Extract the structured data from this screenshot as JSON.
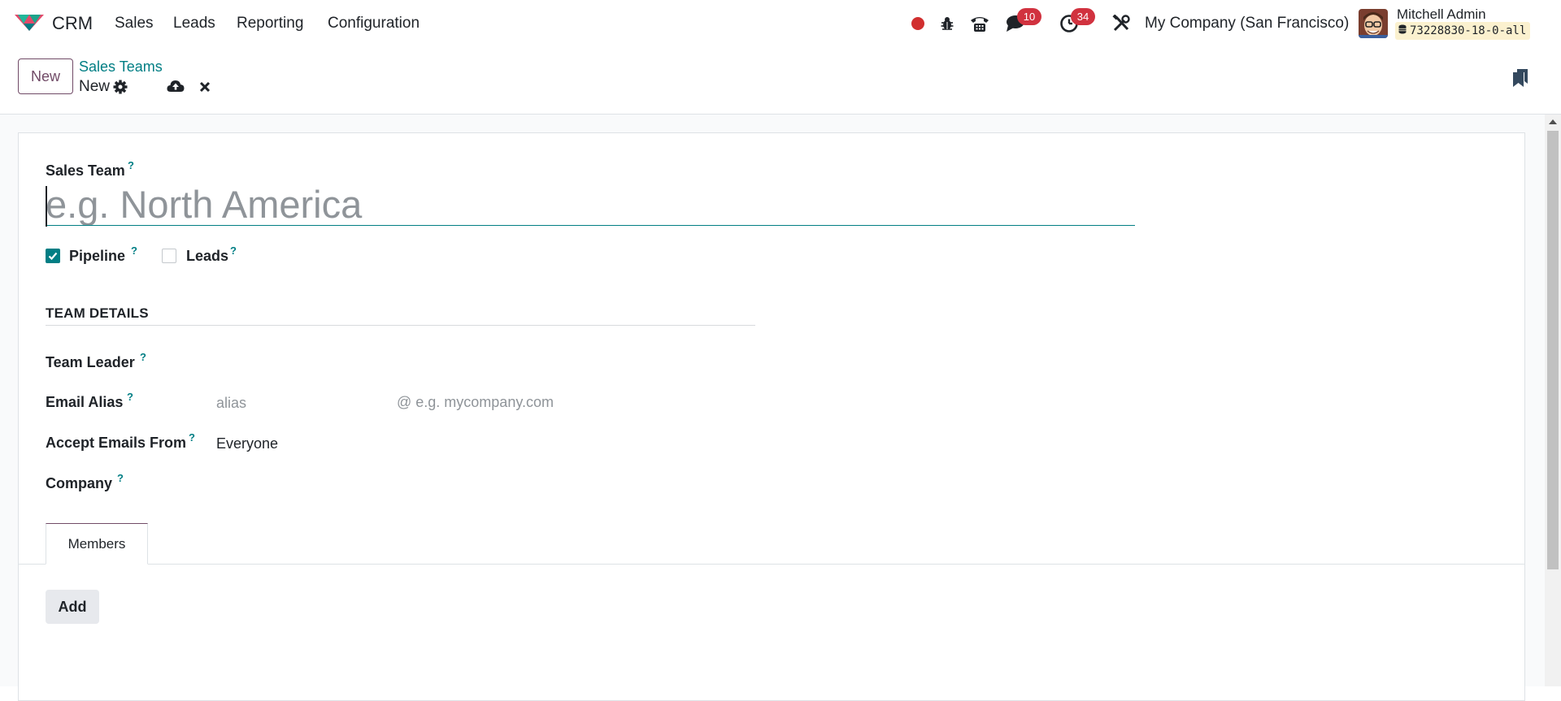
{
  "navbar": {
    "app_name": "CRM",
    "menu": [
      "Sales",
      "Leads",
      "Reporting",
      "Configuration"
    ],
    "messages_count": "10",
    "activities_count": "34",
    "company": "My Company (San Francisco)",
    "user_name": "Mitchell Admin",
    "database": "73228830-18-0-all",
    "icons": [
      "record-icon",
      "bug-icon",
      "phone-icon",
      "chat-icon",
      "clock-icon",
      "tools-icon",
      "database-icon"
    ],
    "colors": {
      "record": "#d12f2f",
      "badge": "#d1323f",
      "primary": "#714b67",
      "accent": "#017e84"
    }
  },
  "breadcrumb": {
    "parent": "Sales Teams",
    "current": "New"
  },
  "actions": {
    "new_label": "New"
  },
  "form": {
    "sales_team_label": "Sales Team",
    "sales_team_placeholder": "e.g. North America",
    "help_mark": "?",
    "pipeline_label": "Pipeline",
    "pipeline_checked": true,
    "leads_label": "Leads",
    "leads_checked": false,
    "section_title": "TEAM DETAILS",
    "team_leader_label": "Team Leader",
    "email_alias_label": "Email Alias",
    "alias_placeholder": "alias",
    "domain_placeholder": "@ e.g. mycompany.com",
    "accept_emails_label": "Accept Emails From",
    "accept_emails_value": "Everyone",
    "company_label": "Company"
  },
  "tabs": [
    "Members"
  ],
  "members": {
    "add_label": "Add"
  }
}
